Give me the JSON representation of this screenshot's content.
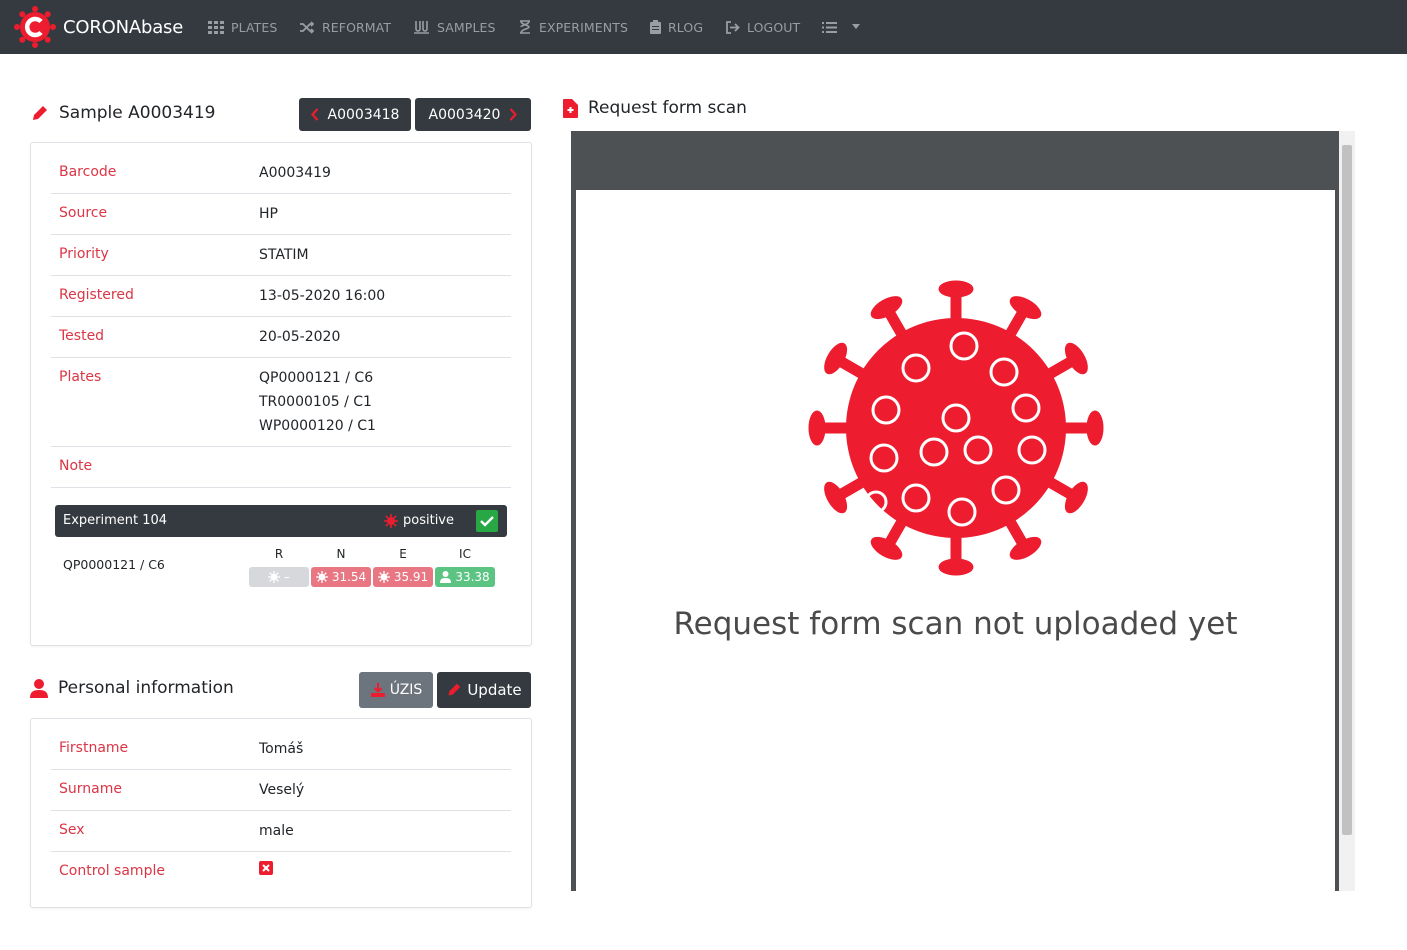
{
  "navbar": {
    "brand": "CORONAbase",
    "items": [
      {
        "icon": "grid-icon",
        "label": "PLATES"
      },
      {
        "icon": "shuffle-icon",
        "label": "REFORMAT"
      },
      {
        "icon": "tubes-icon",
        "label": "SAMPLES"
      },
      {
        "icon": "hourglass-icon",
        "label": "EXPERIMENTS"
      },
      {
        "icon": "clipboard-icon",
        "label": "RLOG"
      },
      {
        "icon": "logout-icon",
        "label": "LOGOUT"
      }
    ]
  },
  "sample": {
    "title": "Sample A0003419",
    "prev_label": "A0003418",
    "next_label": "A0003420",
    "rows": [
      {
        "label": "Barcode",
        "value": "A0003419"
      },
      {
        "label": "Source",
        "value": "HP"
      },
      {
        "label": "Priority",
        "value": "STATIM"
      },
      {
        "label": "Registered",
        "value": "13-05-2020 16:00"
      },
      {
        "label": "Tested",
        "value": "20-05-2020"
      },
      {
        "label": "Plates",
        "values": [
          "QP0000121 / C6",
          "TR0000105 / C1",
          "WP0000120 / C1"
        ]
      },
      {
        "label": "Note",
        "value": ""
      }
    ]
  },
  "experiment": {
    "title": "Experiment 104",
    "result": "positive",
    "plate": "QP0000121 / C6",
    "columns": [
      "R",
      "N",
      "E",
      "IC"
    ],
    "values": [
      "–",
      "31.54",
      "35.91",
      "33.38"
    ],
    "colors": [
      "#d6d8db",
      "#e87783",
      "#e87783",
      "#5cc483"
    ]
  },
  "personal": {
    "title": "Personal information",
    "uzis_label": "ÚZIS",
    "update_label": "Update",
    "rows": [
      {
        "label": "Firstname",
        "value": "Tomáš"
      },
      {
        "label": "Surname",
        "value": "Veselý"
      },
      {
        "label": "Sex",
        "value": "male"
      },
      {
        "label": "Control sample",
        "value": ""
      }
    ]
  },
  "scan": {
    "title": "Request form scan",
    "message": "Request form scan not uploaded yet"
  },
  "colors": {
    "accent": "#ed1c2e",
    "dark": "#343a40",
    "label_red": "#dc3545",
    "check_green": "#28a745"
  }
}
